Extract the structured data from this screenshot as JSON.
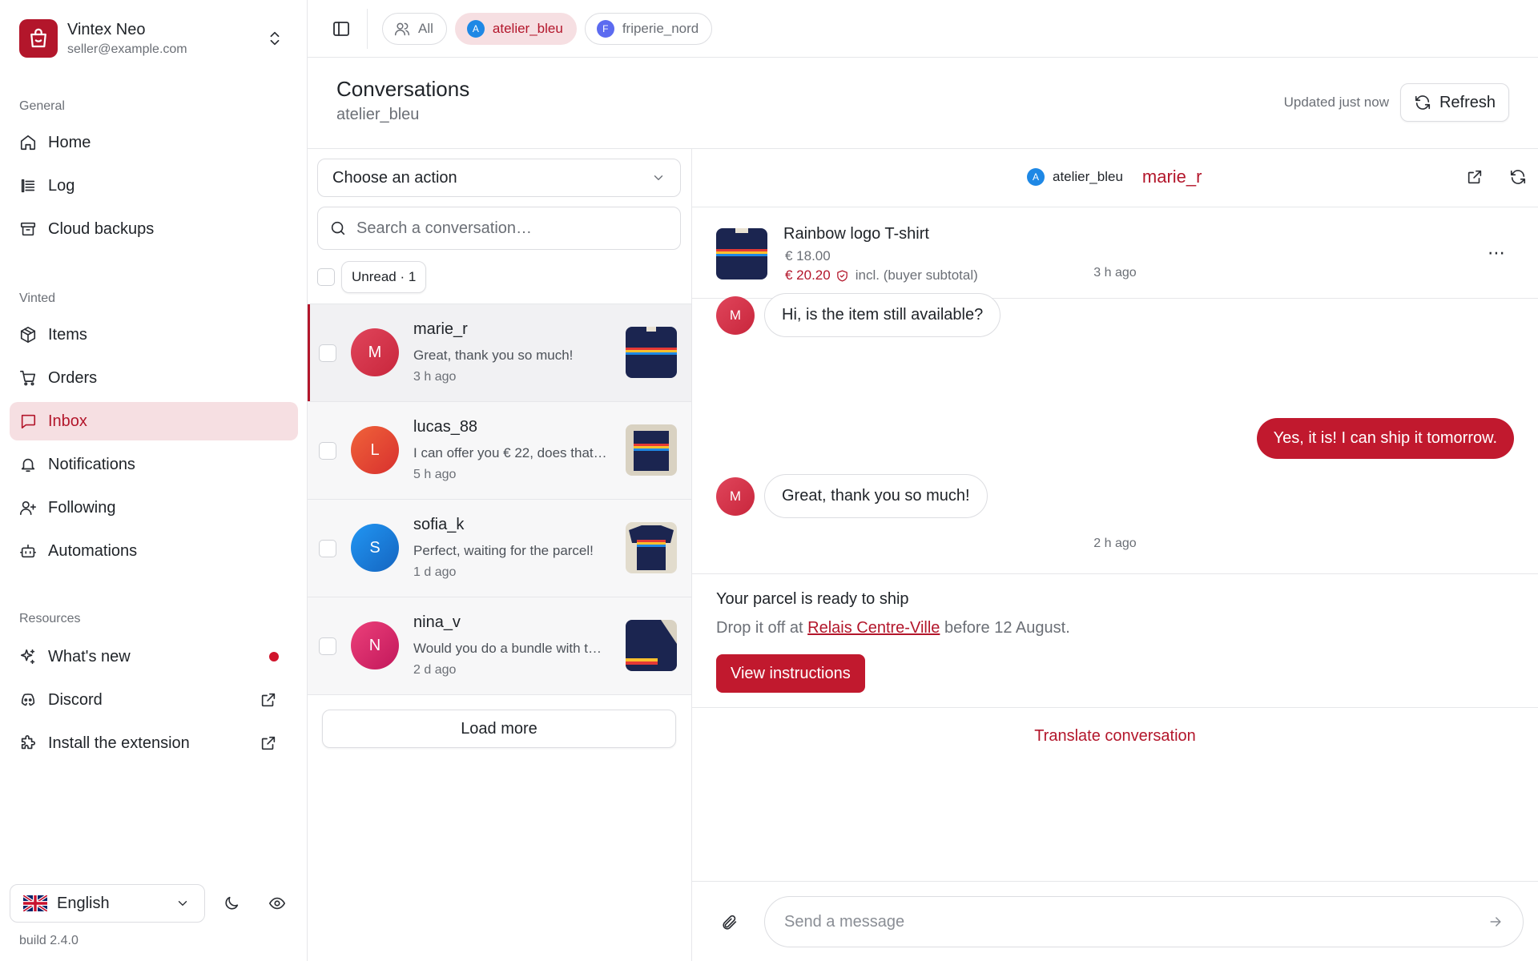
{
  "brand": {
    "name": "Vintex Neo",
    "email": "seller@example.com"
  },
  "sidebar": {
    "general_label": "General",
    "general_items": [
      {
        "label": "Home",
        "icon": "home-icon"
      },
      {
        "label": "Log",
        "icon": "log-icon"
      },
      {
        "label": "Cloud backups",
        "icon": "archive-icon"
      }
    ],
    "vinted_label": "Vinted",
    "vinted_items": [
      {
        "label": "Items",
        "icon": "package-icon"
      },
      {
        "label": "Orders",
        "icon": "cart-icon"
      },
      {
        "label": "Inbox",
        "icon": "message-icon",
        "active": true
      },
      {
        "label": "Notifications",
        "icon": "bell-icon"
      },
      {
        "label": "Following",
        "icon": "user-plus-icon"
      },
      {
        "label": "Automations",
        "icon": "bot-icon"
      }
    ],
    "resources_label": "Resources",
    "resources_items": [
      {
        "label": "What's new",
        "icon": "sparkles-icon",
        "badge": "red-dot"
      },
      {
        "label": "Discord",
        "icon": "discord-icon",
        "trail": "external-link-icon"
      },
      {
        "label": "Install the extension",
        "icon": "puzzle-icon",
        "trail": "external-link-icon"
      }
    ],
    "language": "English",
    "build": "build 2.4.0"
  },
  "topbar": {
    "chips": [
      {
        "label": "All"
      },
      {
        "label": "atelier_bleu",
        "initial": "A",
        "active": true
      },
      {
        "label": "friperie_nord",
        "initial": "F"
      }
    ]
  },
  "page": {
    "title": "Conversations",
    "subtitle": "atelier_bleu",
    "updated": "Updated just now",
    "refresh": "Refresh"
  },
  "list": {
    "action_select": "Choose an action",
    "search_placeholder": "Search a conversation…",
    "unread_filter": "Unread · 1",
    "conversations": [
      {
        "initial": "M",
        "name": "marie_r",
        "message": "Great, thank you so much!",
        "time": "3 h ago"
      },
      {
        "initial": "L",
        "name": "lucas_88",
        "message": "I can offer you  € 22, does that work?",
        "time": "5 h ago"
      },
      {
        "initial": "S",
        "name": "sofia_k",
        "message": "Perfect, waiting for the parcel!",
        "time": "1 d ago"
      },
      {
        "initial": "N",
        "name": "nina_v",
        "message": "Would you do a bundle with the jeans?",
        "time": "2 d ago"
      }
    ],
    "load_more": "Load more"
  },
  "chat": {
    "account_initial": "A",
    "account": "atelier_bleu",
    "user": "marie_r",
    "product": {
      "title": "Rainbow logo T-shirt",
      "price": "€ 18.00",
      "total": "€ 20.20",
      "total_note": "incl. (buyer subtotal)"
    },
    "timestamp_1": "3 h ago",
    "messages": [
      {
        "from": "buyer",
        "initial": "M",
        "text": "Hi, is the item still available?"
      },
      {
        "from": "seller",
        "text": "Yes, it is! I can ship it tomorrow."
      },
      {
        "from": "buyer",
        "initial": "M",
        "text": "Great, thank you so much!"
      }
    ],
    "timestamp_2": "2 h ago",
    "shipping": {
      "title": "Your parcel is ready to ship",
      "desc_prefix": "Drop it off at ",
      "location": "Relais Centre-Ville",
      "desc_suffix": " before 12 August.",
      "button": "View instructions"
    },
    "translate": "Translate conversation",
    "composer_placeholder": "Send a message"
  },
  "colors": {
    "accent": "#b3162b",
    "accent_soft": "#f6dfe2",
    "border": "#e6e7ea"
  }
}
